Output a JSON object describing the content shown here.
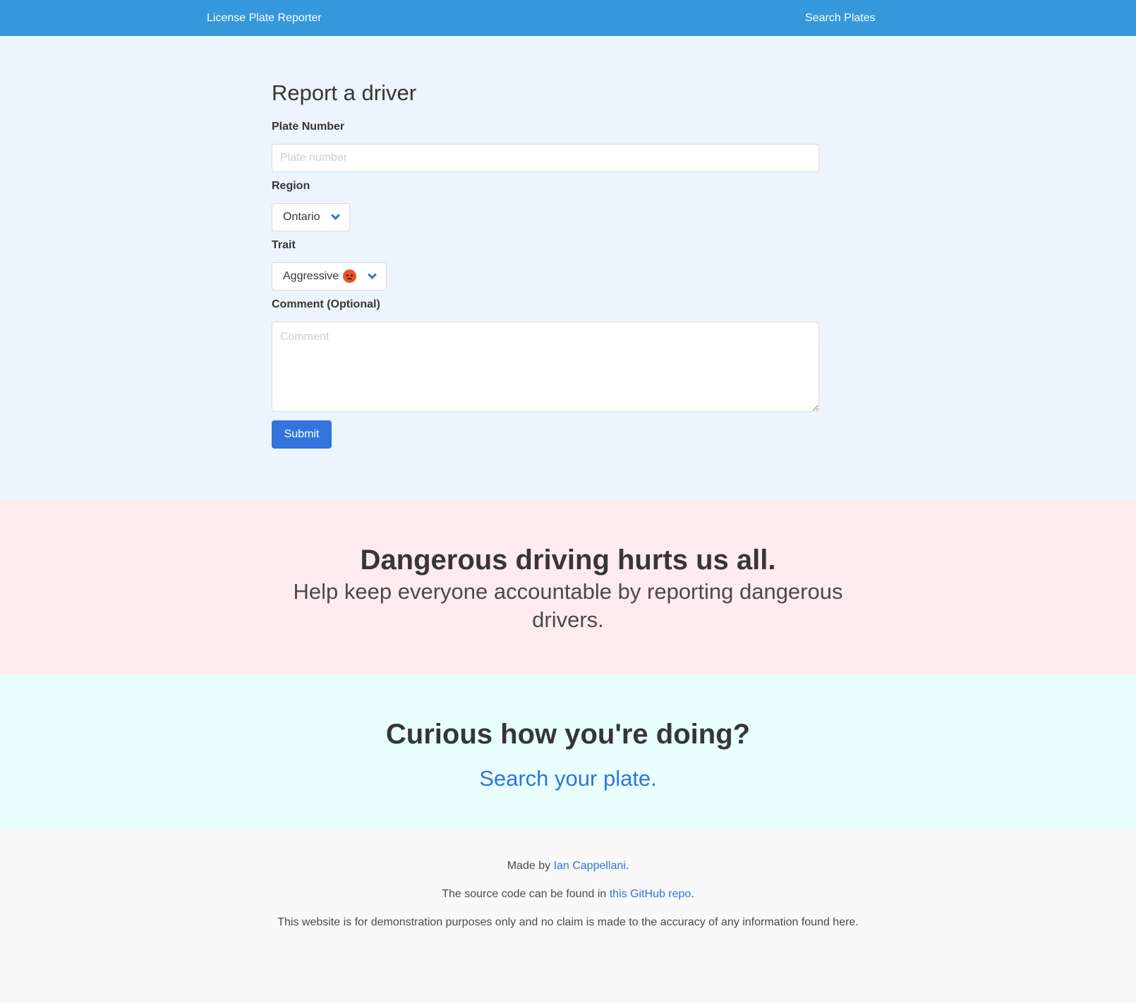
{
  "navbar": {
    "brand": "License Plate Reporter",
    "search_link": "Search Plates"
  },
  "form": {
    "title": "Report a driver",
    "plate_label": "Plate Number",
    "plate_placeholder": "Plate number",
    "plate_value": "",
    "region_label": "Region",
    "region_selected": "Ontario",
    "trait_label": "Trait",
    "trait_selected": "Aggressive",
    "trait_emoji_icon": "angry-face-icon",
    "comment_label": "Comment (Optional)",
    "comment_placeholder": "Comment",
    "comment_value": "",
    "submit_label": "Submit"
  },
  "banner": {
    "title": "Dangerous driving hurts us all.",
    "subtitle": "Help keep everyone accountable by reporting dangerous drivers."
  },
  "cta": {
    "title": "Curious how you're doing?",
    "link": "Search your plate."
  },
  "footer": {
    "made_by_prefix": "Made by ",
    "author": "Ian Cappellani",
    "made_by_suffix": ".",
    "source_prefix": "The source code can be found in ",
    "source_link": "this GitHub repo",
    "source_suffix": ".",
    "disclaimer": "This website is for demonstration purposes only and no claim is made to the accuracy of any information found here."
  },
  "colors": {
    "navbar": "#3498db",
    "link": "#3273dc",
    "form_bg": "#ecf4fd",
    "banner_pink": "#feebf0",
    "banner_cyan": "#e9fffd",
    "footer_bg": "#f9f9f9"
  }
}
